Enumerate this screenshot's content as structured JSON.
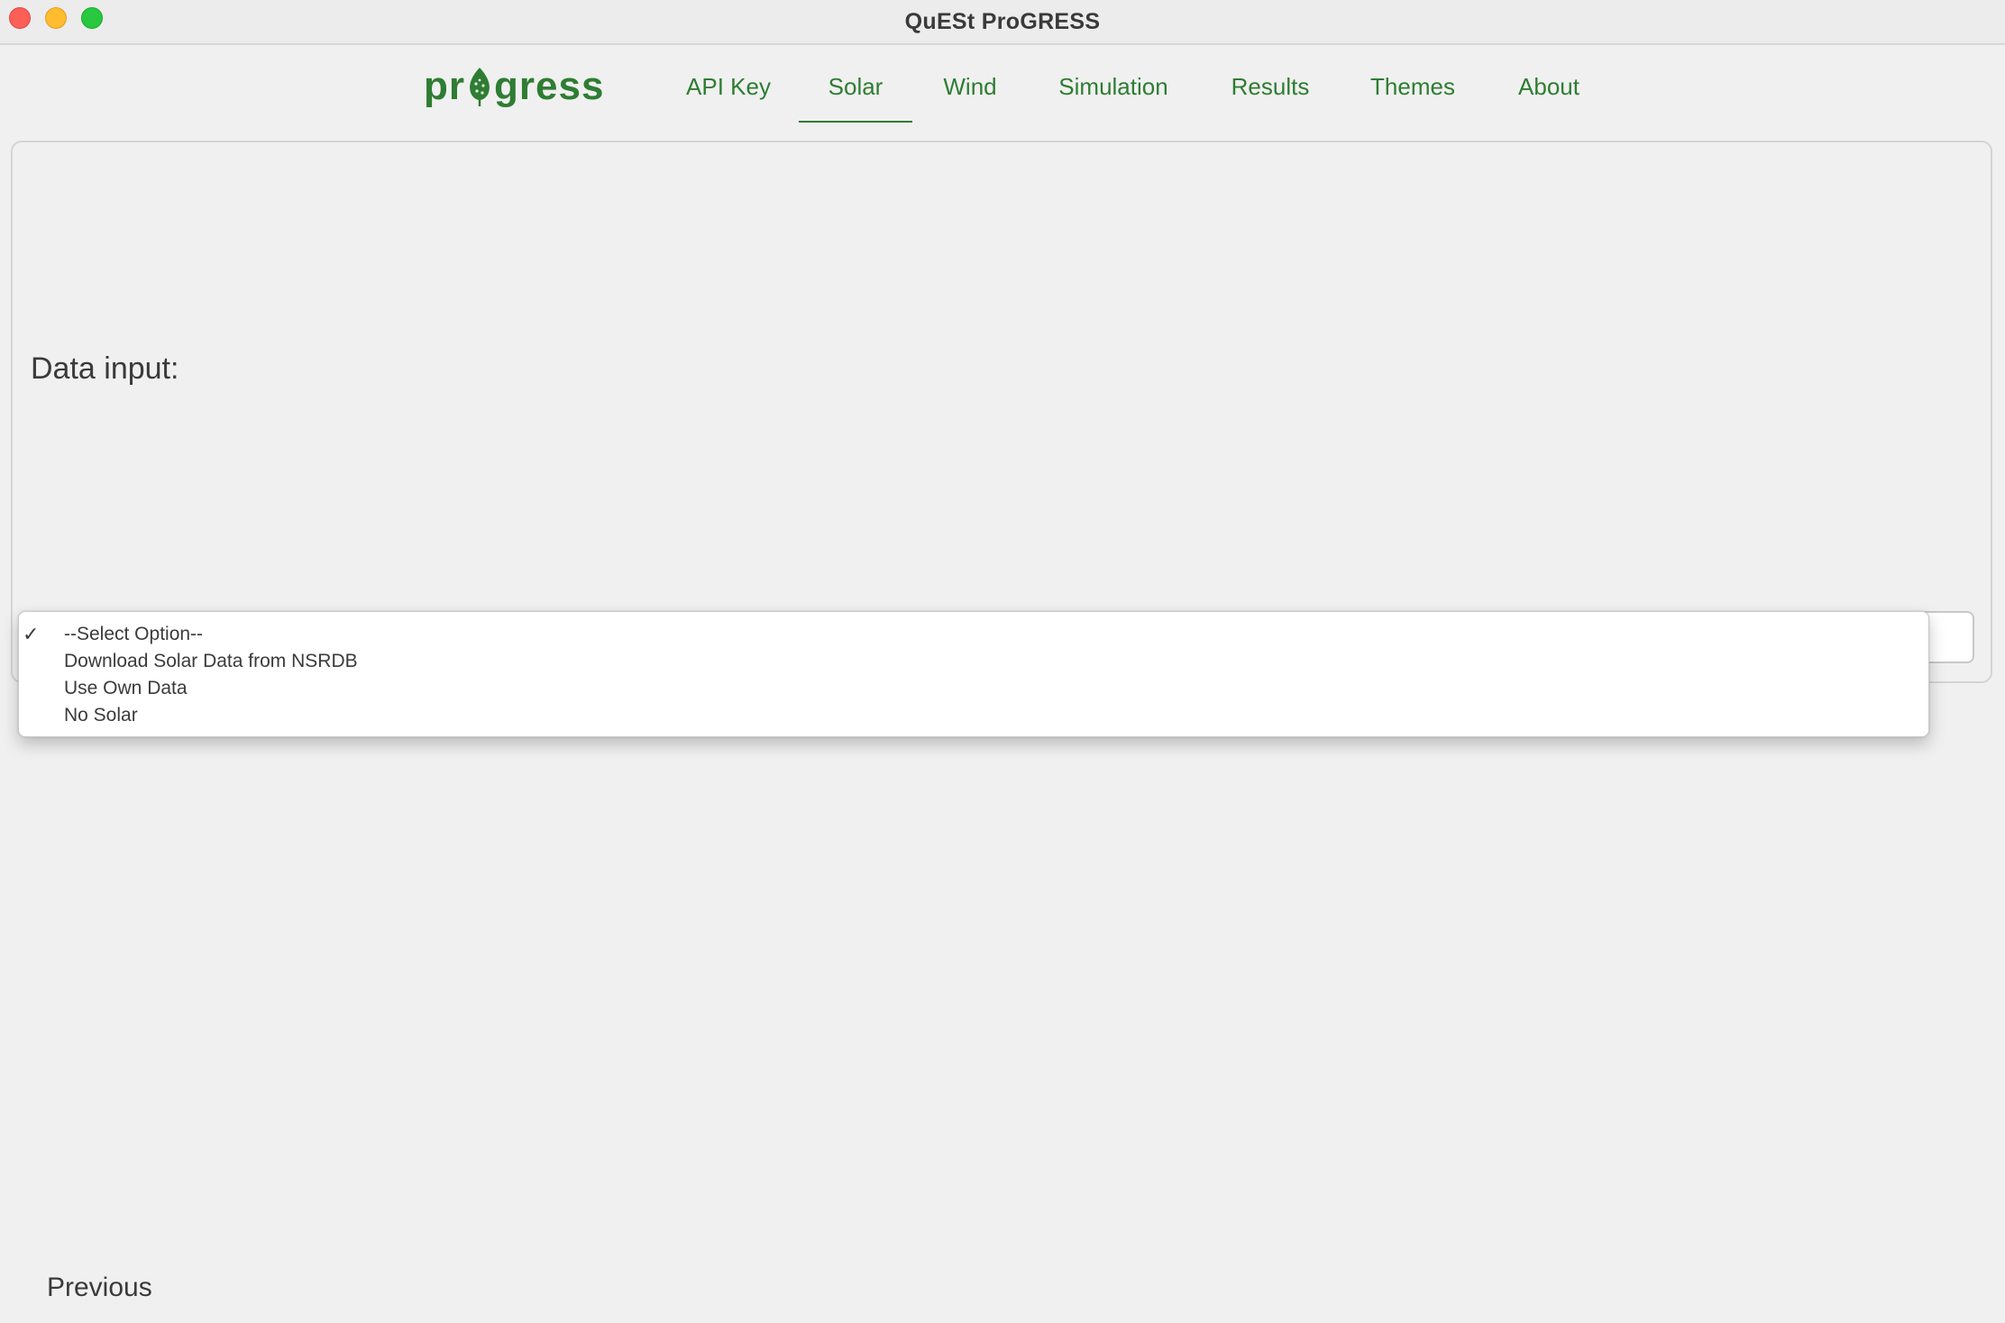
{
  "window": {
    "title": "QuESt ProGRESS"
  },
  "logo": {
    "text_before": "pr",
    "text_after": "gress",
    "color": "#2e7d32"
  },
  "nav": {
    "tabs": [
      {
        "label": "API Key"
      },
      {
        "label": "Solar",
        "active": true
      },
      {
        "label": "Wind"
      },
      {
        "label": "Simulation"
      },
      {
        "label": "Results"
      },
      {
        "label": "Themes"
      },
      {
        "label": "About"
      }
    ]
  },
  "main": {
    "data_input_label": "Data input:",
    "dropdown": {
      "options": [
        {
          "label": "--Select Option--",
          "checked": true
        },
        {
          "label": "Download Solar Data from NSRDB"
        },
        {
          "label": "Use Own Data"
        },
        {
          "label": "No Solar"
        }
      ],
      "check_glyph": "✓"
    }
  },
  "footer": {
    "previous_label": "Previous"
  },
  "colors": {
    "accent": "#2e7d32",
    "text": "#3a3a3a",
    "background": "#f0f0f0"
  }
}
